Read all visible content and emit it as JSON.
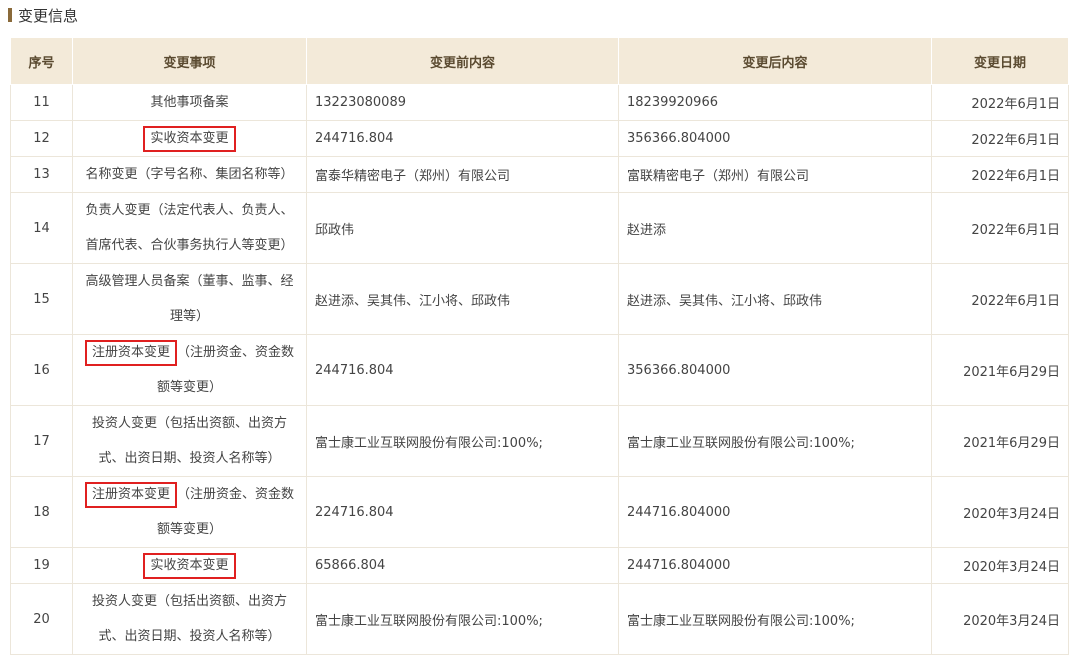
{
  "section": {
    "title": "变更信息"
  },
  "table": {
    "headers": {
      "idx": "序号",
      "item": "变更事项",
      "before": "变更前内容",
      "after": "变更后内容",
      "date": "变更日期"
    },
    "rows": [
      {
        "idx": "11",
        "item_hl": "",
        "item": "其他事项备案",
        "before": "13223080089",
        "after": "18239920966",
        "date": "2022年6月1日"
      },
      {
        "idx": "12",
        "item_hl": "实收资本变更",
        "item": "",
        "before": "244716.804",
        "after": "356366.804000",
        "date": "2022年6月1日"
      },
      {
        "idx": "13",
        "item_hl": "",
        "item": "名称变更（字号名称、集团名称等）",
        "before": "富泰华精密电子（郑州）有限公司",
        "after": "富联精密电子（郑州）有限公司",
        "date": "2022年6月1日"
      },
      {
        "idx": "14",
        "item_hl": "",
        "item": "负责人变更（法定代表人、负责人、首席代表、合伙事务执行人等变更）",
        "before": "邱政伟",
        "after": "赵进添",
        "date": "2022年6月1日"
      },
      {
        "idx": "15",
        "item_hl": "",
        "item": "高级管理人员备案（董事、监事、经理等）",
        "before": "赵进添、吴其伟、江小将、邱政伟",
        "after": "赵进添、吴其伟、江小将、邱政伟",
        "date": "2022年6月1日"
      },
      {
        "idx": "16",
        "item_hl": "注册资本变更",
        "item": "（注册资金、资金数额等变更）",
        "before": "244716.804",
        "after": "356366.804000",
        "date": "2021年6月29日"
      },
      {
        "idx": "17",
        "item_hl": "",
        "item": "投资人变更（包括出资额、出资方式、出资日期、投资人名称等）",
        "before": "富士康工业互联网股份有限公司:100%;",
        "after": "富士康工业互联网股份有限公司:100%;",
        "date": "2021年6月29日"
      },
      {
        "idx": "18",
        "item_hl": "注册资本变更",
        "item": "（注册资金、资金数额等变更）",
        "before": "224716.804",
        "after": "244716.804000",
        "date": "2020年3月24日"
      },
      {
        "idx": "19",
        "item_hl": "实收资本变更",
        "item": "",
        "before": "65866.804",
        "after": "244716.804000",
        "date": "2020年3月24日"
      },
      {
        "idx": "20",
        "item_hl": "",
        "item": "投资人变更（包括出资额、出资方式、出资日期、投资人名称等）",
        "before": "富士康工业互联网股份有限公司:100%;",
        "after": "富士康工业互联网股份有限公司:100%;",
        "date": "2020年3月24日"
      }
    ]
  },
  "colors": {
    "header_bg": "#f3ead9",
    "highlight": "#e02020",
    "accent": "#8a6a3a"
  }
}
